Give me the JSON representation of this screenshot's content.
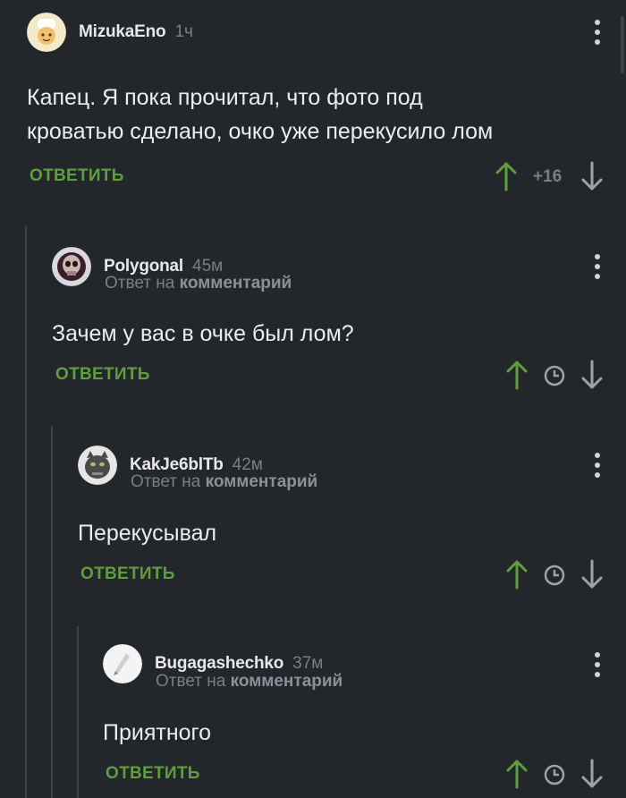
{
  "comments": [
    {
      "user": "MizukaEno",
      "time": "1ч",
      "text_line1": "Капец. Я пока прочитал, что фото под",
      "text_line2": "кроватью сделано, очко уже перекусило лом",
      "reply_label": "ОТВЕТИТЬ",
      "rating": "+16"
    },
    {
      "user": "Polygonal",
      "time": "45м",
      "reply_prefix": "Ответ на",
      "reply_target": "комментарий",
      "text": "Зачем у вас в очке был лом?",
      "reply_label": "ОТВЕТИТЬ"
    },
    {
      "user": "KakJe6blTb",
      "time": "42м",
      "reply_prefix": "Ответ на",
      "reply_target": "комментарий",
      "text": "Перекусывал",
      "reply_label": "ОТВЕТИТЬ"
    },
    {
      "user": "Bugagashechko",
      "time": "37м",
      "reply_prefix": "Ответ на",
      "reply_target": "комментарий",
      "text": "Приятного",
      "reply_label": "ОТВЕТИТЬ"
    }
  ],
  "colors": {
    "background": "#23272b",
    "accent_green": "#5e9e3d",
    "muted_text": "#7a7f84"
  }
}
